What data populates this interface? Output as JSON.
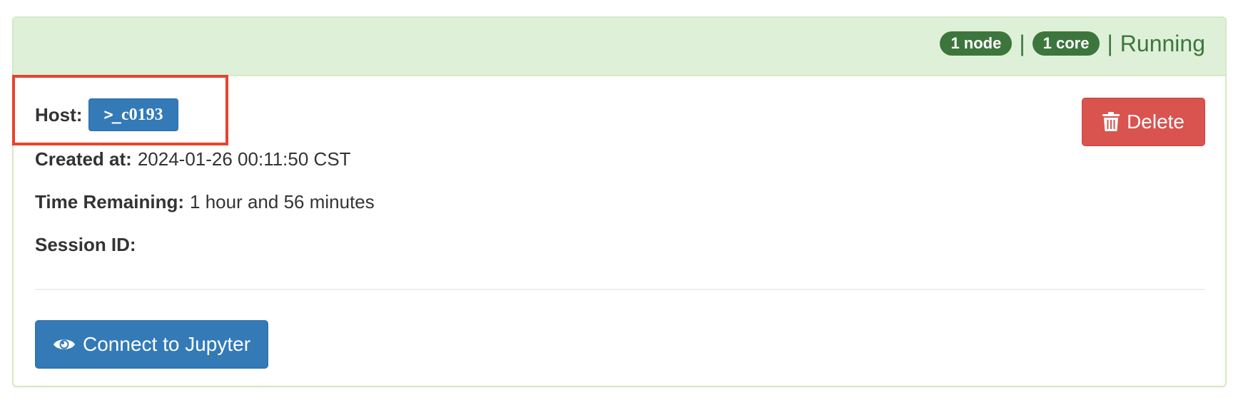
{
  "header": {
    "nodes_badge": "1 node",
    "separator": "|",
    "cores_badge": "1 core",
    "status": "Running"
  },
  "session": {
    "host_label": "Host:",
    "host_prompt": ">_",
    "host_name": "c0193",
    "created_label": "Created at:",
    "created_value": "2024-01-26 00:11:50 CST",
    "remaining_label": "Time Remaining:",
    "remaining_value": "1 hour and 56 minutes",
    "session_id_label": "Session ID:",
    "session_id_value": ""
  },
  "actions": {
    "delete_label": "Delete",
    "connect_label": "Connect to Jupyter"
  },
  "icons": {
    "host": "terminal-icon",
    "delete": "trash-icon",
    "connect": "eye-icon"
  },
  "colors": {
    "header_bg": "#dff0d8",
    "success": "#3c763d",
    "primary": "#337ab7",
    "danger": "#d9534f",
    "highlight": "#e8432f"
  }
}
